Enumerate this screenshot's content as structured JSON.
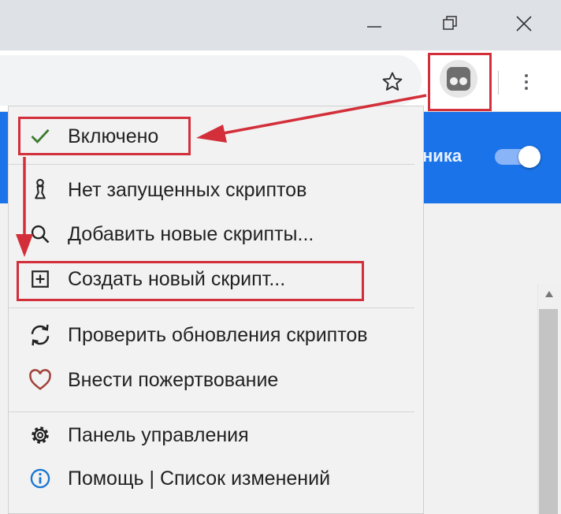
{
  "window": {
    "controls": {
      "minimize_icon": "minimize-icon",
      "restore_icon": "restore-icon",
      "close_icon": "close-icon"
    }
  },
  "toolbar": {
    "bookmark_icon": "star-icon",
    "extension_icon": "tampermonkey-icon",
    "menu_icon": "kebab-menu-icon"
  },
  "page": {
    "banner_text": "ника",
    "toggle": {
      "on": true
    }
  },
  "menu": {
    "sections": [
      {
        "items": [
          {
            "label": "Включено",
            "icon": "check-icon"
          }
        ]
      },
      {
        "items": [
          {
            "label": "Нет запущенных скриптов",
            "icon": "chess-pawn-icon"
          },
          {
            "label": "Добавить новые скрипты...",
            "icon": "search-icon"
          },
          {
            "label": "Создать новый скрипт...",
            "icon": "plus-square-icon"
          }
        ]
      },
      {
        "items": [
          {
            "label": "Проверить обновления скриптов",
            "icon": "sync-icon"
          },
          {
            "label": "Внести пожертвование",
            "icon": "heart-icon"
          }
        ]
      },
      {
        "items": [
          {
            "label": "Панель управления",
            "icon": "gear-icon"
          },
          {
            "label": "Помощь | Список изменений",
            "icon": "info-icon"
          }
        ]
      }
    ]
  },
  "colors": {
    "annotation": "#d32f3a",
    "banner": "#1a73e8",
    "check": "#3c7a2e",
    "heart": "#a0423a",
    "info": "#1976d2"
  }
}
